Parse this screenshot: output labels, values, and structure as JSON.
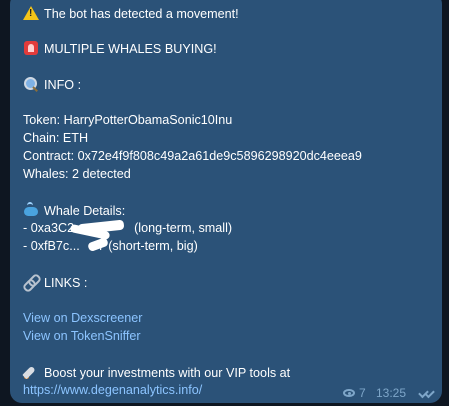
{
  "message": {
    "alert_line": "The bot has detected a movement!",
    "headline": "MULTIPLE WHALES BUYING!",
    "info_header": "INFO :",
    "token_line": "Token: HarryPotterObamaSonic10Inu",
    "chain_line": "Chain: ETH",
    "contract_line": "Contract: 0x72e4f9f808c49a2a61de9c5896298920dc4eeea9",
    "whales_line": "Whales: 2 detected",
    "whale_details_header": "Whale Details:",
    "whale_1_prefix": "- 0xa3C2",
    "whale_1_suffix": "(long-term, small)",
    "whale_2_prefix": "- 0xfB7c...",
    "whale_2_suffix": "7 (short-term, big)",
    "links_header": "LINKS :",
    "link_dexscreener": "View on Dexscreener",
    "link_tokensniffer": "View on TokenSniffer",
    "promo_line": "Boost your investments with our VIP tools at",
    "promo_url": "https://www.degenanalytics.info/"
  },
  "footer": {
    "views": "7",
    "time": "13:25"
  },
  "icons": {
    "alert": "warning-icon",
    "headline": "siren-icon",
    "info": "magnifier-icon",
    "whale": "whale-icon",
    "links": "link-icon",
    "promo": "rocket-icon",
    "views": "eye-icon",
    "status": "double-check-icon"
  },
  "colors": {
    "background": "#0e1621",
    "bubble": "#2b5278",
    "text": "#ffffff",
    "link": "#8cc4ff",
    "meta": "#7ea6c9"
  }
}
